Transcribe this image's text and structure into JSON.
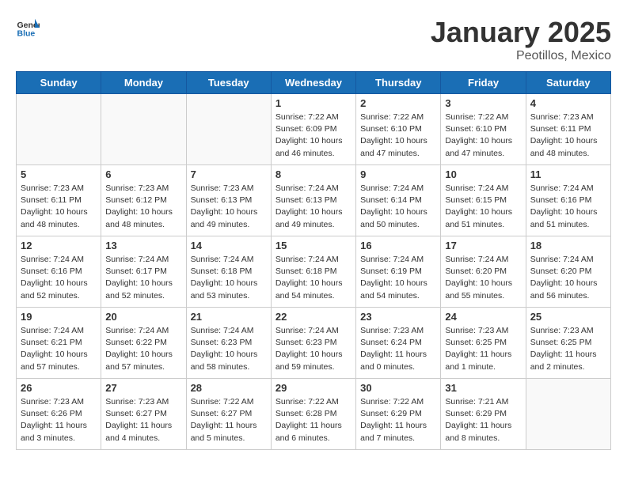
{
  "header": {
    "logo_general": "General",
    "logo_blue": "Blue",
    "title": "January 2025",
    "subtitle": "Peotillos, Mexico"
  },
  "days_of_week": [
    "Sunday",
    "Monday",
    "Tuesday",
    "Wednesday",
    "Thursday",
    "Friday",
    "Saturday"
  ],
  "weeks": [
    [
      {
        "day": "",
        "info": ""
      },
      {
        "day": "",
        "info": ""
      },
      {
        "day": "",
        "info": ""
      },
      {
        "day": "1",
        "info": "Sunrise: 7:22 AM\nSunset: 6:09 PM\nDaylight: 10 hours and 46 minutes."
      },
      {
        "day": "2",
        "info": "Sunrise: 7:22 AM\nSunset: 6:10 PM\nDaylight: 10 hours and 47 minutes."
      },
      {
        "day": "3",
        "info": "Sunrise: 7:22 AM\nSunset: 6:10 PM\nDaylight: 10 hours and 47 minutes."
      },
      {
        "day": "4",
        "info": "Sunrise: 7:23 AM\nSunset: 6:11 PM\nDaylight: 10 hours and 48 minutes."
      }
    ],
    [
      {
        "day": "5",
        "info": "Sunrise: 7:23 AM\nSunset: 6:11 PM\nDaylight: 10 hours and 48 minutes."
      },
      {
        "day": "6",
        "info": "Sunrise: 7:23 AM\nSunset: 6:12 PM\nDaylight: 10 hours and 48 minutes."
      },
      {
        "day": "7",
        "info": "Sunrise: 7:23 AM\nSunset: 6:13 PM\nDaylight: 10 hours and 49 minutes."
      },
      {
        "day": "8",
        "info": "Sunrise: 7:24 AM\nSunset: 6:13 PM\nDaylight: 10 hours and 49 minutes."
      },
      {
        "day": "9",
        "info": "Sunrise: 7:24 AM\nSunset: 6:14 PM\nDaylight: 10 hours and 50 minutes."
      },
      {
        "day": "10",
        "info": "Sunrise: 7:24 AM\nSunset: 6:15 PM\nDaylight: 10 hours and 51 minutes."
      },
      {
        "day": "11",
        "info": "Sunrise: 7:24 AM\nSunset: 6:16 PM\nDaylight: 10 hours and 51 minutes."
      }
    ],
    [
      {
        "day": "12",
        "info": "Sunrise: 7:24 AM\nSunset: 6:16 PM\nDaylight: 10 hours and 52 minutes."
      },
      {
        "day": "13",
        "info": "Sunrise: 7:24 AM\nSunset: 6:17 PM\nDaylight: 10 hours and 52 minutes."
      },
      {
        "day": "14",
        "info": "Sunrise: 7:24 AM\nSunset: 6:18 PM\nDaylight: 10 hours and 53 minutes."
      },
      {
        "day": "15",
        "info": "Sunrise: 7:24 AM\nSunset: 6:18 PM\nDaylight: 10 hours and 54 minutes."
      },
      {
        "day": "16",
        "info": "Sunrise: 7:24 AM\nSunset: 6:19 PM\nDaylight: 10 hours and 54 minutes."
      },
      {
        "day": "17",
        "info": "Sunrise: 7:24 AM\nSunset: 6:20 PM\nDaylight: 10 hours and 55 minutes."
      },
      {
        "day": "18",
        "info": "Sunrise: 7:24 AM\nSunset: 6:20 PM\nDaylight: 10 hours and 56 minutes."
      }
    ],
    [
      {
        "day": "19",
        "info": "Sunrise: 7:24 AM\nSunset: 6:21 PM\nDaylight: 10 hours and 57 minutes."
      },
      {
        "day": "20",
        "info": "Sunrise: 7:24 AM\nSunset: 6:22 PM\nDaylight: 10 hours and 57 minutes."
      },
      {
        "day": "21",
        "info": "Sunrise: 7:24 AM\nSunset: 6:23 PM\nDaylight: 10 hours and 58 minutes."
      },
      {
        "day": "22",
        "info": "Sunrise: 7:24 AM\nSunset: 6:23 PM\nDaylight: 10 hours and 59 minutes."
      },
      {
        "day": "23",
        "info": "Sunrise: 7:23 AM\nSunset: 6:24 PM\nDaylight: 11 hours and 0 minutes."
      },
      {
        "day": "24",
        "info": "Sunrise: 7:23 AM\nSunset: 6:25 PM\nDaylight: 11 hours and 1 minute."
      },
      {
        "day": "25",
        "info": "Sunrise: 7:23 AM\nSunset: 6:25 PM\nDaylight: 11 hours and 2 minutes."
      }
    ],
    [
      {
        "day": "26",
        "info": "Sunrise: 7:23 AM\nSunset: 6:26 PM\nDaylight: 11 hours and 3 minutes."
      },
      {
        "day": "27",
        "info": "Sunrise: 7:23 AM\nSunset: 6:27 PM\nDaylight: 11 hours and 4 minutes."
      },
      {
        "day": "28",
        "info": "Sunrise: 7:22 AM\nSunset: 6:27 PM\nDaylight: 11 hours and 5 minutes."
      },
      {
        "day": "29",
        "info": "Sunrise: 7:22 AM\nSunset: 6:28 PM\nDaylight: 11 hours and 6 minutes."
      },
      {
        "day": "30",
        "info": "Sunrise: 7:22 AM\nSunset: 6:29 PM\nDaylight: 11 hours and 7 minutes."
      },
      {
        "day": "31",
        "info": "Sunrise: 7:21 AM\nSunset: 6:29 PM\nDaylight: 11 hours and 8 minutes."
      },
      {
        "day": "",
        "info": ""
      }
    ]
  ]
}
